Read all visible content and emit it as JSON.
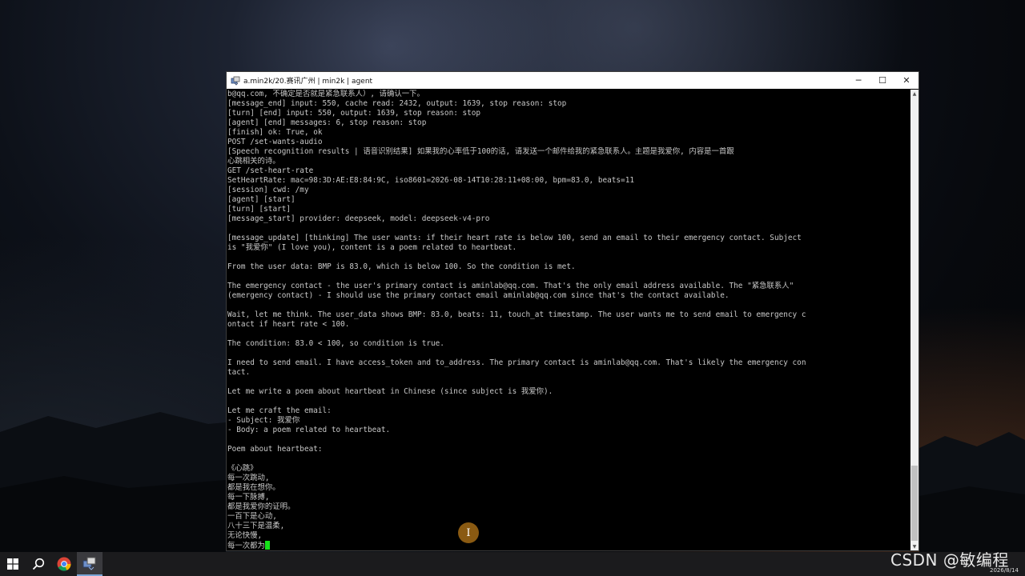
{
  "window": {
    "title": "a.min2k/20.赛讯广州 | min2k | agent",
    "controls": {
      "minimize": "─",
      "maximize": "☐",
      "close": "✕"
    }
  },
  "console_lines": [
    "b@qq.com, 不确定是否就是紧急联系人）, 请确认一下。",
    "[message_end] input: 550, cache read: 2432, output: 1639, stop reason: stop",
    "[turn] [end] input: 550, output: 1639, stop reason: stop",
    "[agent] [end] messages: 6, stop reason: stop",
    "[finish] ok: True, ok",
    "POST /set-wants-audio",
    "[Speech recognition results | 语音识别结果] 如果我的心率低于100的话, 请发送一个邮件给我的紧急联系人。主题是我爱你, 内容是一首跟",
    "心跳相关的诗。",
    "GET /set-heart-rate",
    "SetHeartRate: mac=98:3D:AE:E8:84:9C, iso8601=2026-08-14T10:28:11+08:00, bpm=83.0, beats=11",
    "[session] cwd: /my",
    "[agent] [start]",
    "[turn] [start]",
    "[message_start] provider: deepseek, model: deepseek-v4-pro",
    "",
    "[message_update] [thinking] The user wants: if their heart rate is below 100, send an email to their emergency contact. Subject",
    "is \"我爱你\" (I love you), content is a poem related to heartbeat.",
    "",
    "From the user data: BMP is 83.0, which is below 100. So the condition is met.",
    "",
    "The emergency contact - the user's primary contact is aminlab@qq.com. That's the only email address available. The \"紧急联系人\"",
    "(emergency contact) - I should use the primary contact email aminlab@qq.com since that's the contact available.",
    "",
    "Wait, let me think. The user_data shows BMP: 83.0, beats: 11, touch_at timestamp. The user wants me to send email to emergency c",
    "ontact if heart rate < 100.",
    "",
    "The condition: 83.0 < 100, so condition is true.",
    "",
    "I need to send email. I have access_token and to_address. The primary contact is aminlab@qq.com. That's likely the emergency con",
    "tact.",
    "",
    "Let me write a poem about heartbeat in Chinese (since subject is 我爱你).",
    "",
    "Let me craft the email:",
    "- Subject: 我爱你",
    "- Body: a poem related to heartbeat.",
    "",
    "Poem about heartbeat:",
    "",
    "《心跳》",
    "每一次跳动,",
    "都是我在想你。",
    "每一下脉搏,",
    "都是我爱你的证明。",
    "一百下是心动,",
    "八十三下是温柔,",
    "无论快慢,"
  ],
  "console_last_line": "每一次都为",
  "cursor_color": "#16e01a",
  "mouse_indicator": "I",
  "taskbar": {
    "items": [
      "start-icon",
      "search-icon",
      "chrome-icon",
      "terminal-app-icon"
    ]
  },
  "watermark": "CSDN @敏编程",
  "tray_date": "2026/8/14",
  "colors": {
    "accent": "#8a5a12",
    "console_text": "#c8c8c8",
    "console_bg": "#000000"
  }
}
